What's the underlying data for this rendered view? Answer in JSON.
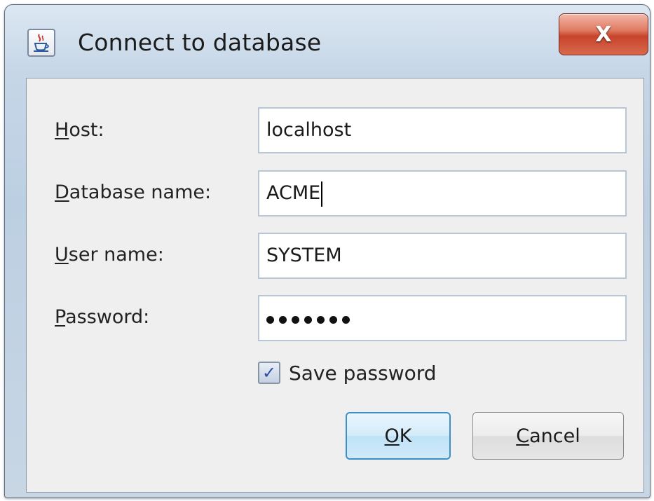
{
  "window": {
    "title": "Connect to database",
    "close_label": "X",
    "app_icon": "java-cup-icon"
  },
  "form": {
    "host_label_mnemonic": "H",
    "host_label_rest": "ost:",
    "host_value": "localhost",
    "dbname_label_mnemonic": "D",
    "dbname_label_rest": "atabase name:",
    "dbname_value": "ACME",
    "user_label_mnemonic": "U",
    "user_label_rest": "ser name:",
    "user_value": "SYSTEM",
    "password_label_mnemonic": "P",
    "password_label_rest": "assword:",
    "password_masked_length": 7,
    "save_password_label": "Save password",
    "save_password_checked": true
  },
  "buttons": {
    "ok_mnemonic": "O",
    "ok_rest": "K",
    "cancel_mnemonic": "C",
    "cancel_rest": "ancel"
  },
  "colors": {
    "close_button": "#c7432c",
    "ok_border": "#3f8fc7",
    "check_mark": "#2c4fa3"
  }
}
